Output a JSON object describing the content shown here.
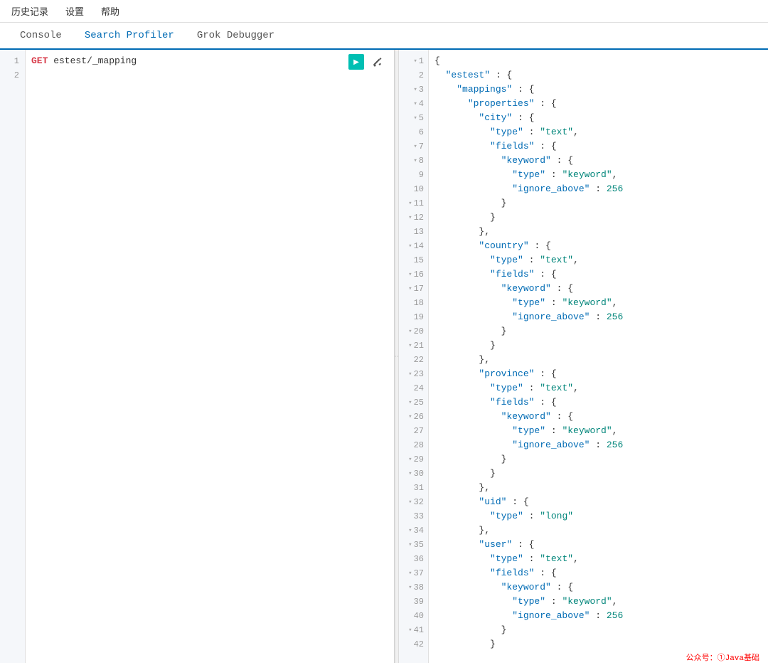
{
  "menu": {
    "items": [
      "历史记录",
      "设置",
      "帮助"
    ]
  },
  "tabs": [
    {
      "id": "console",
      "label": "Console",
      "active": false
    },
    {
      "id": "search-profiler",
      "label": "Search Profiler",
      "active": true
    },
    {
      "id": "grok-debugger",
      "label": "Grok Debugger",
      "active": false
    }
  ],
  "editor": {
    "lines": [
      {
        "num": 1,
        "content": "GET estest/_mapping"
      },
      {
        "num": 2,
        "content": ""
      }
    ]
  },
  "output": {
    "lines": [
      {
        "num": 1,
        "fold": true,
        "text": "{"
      },
      {
        "num": 2,
        "fold": false,
        "text": "  \"estest\" : {"
      },
      {
        "num": 3,
        "fold": true,
        "text": "    \"mappings\" : {"
      },
      {
        "num": 4,
        "fold": true,
        "text": "      \"properties\" : {"
      },
      {
        "num": 5,
        "fold": true,
        "text": "        \"city\" : {"
      },
      {
        "num": 6,
        "fold": false,
        "text": "          \"type\" : \"text\","
      },
      {
        "num": 7,
        "fold": true,
        "text": "          \"fields\" : {"
      },
      {
        "num": 8,
        "fold": true,
        "text": "            \"keyword\" : {"
      },
      {
        "num": 9,
        "fold": false,
        "text": "              \"type\" : \"keyword\","
      },
      {
        "num": 10,
        "fold": false,
        "text": "              \"ignore_above\" : 256"
      },
      {
        "num": 11,
        "fold": true,
        "text": "            }"
      },
      {
        "num": 12,
        "fold": true,
        "text": "          }"
      },
      {
        "num": 13,
        "fold": false,
        "text": "        },"
      },
      {
        "num": 14,
        "fold": true,
        "text": "        \"country\" : {"
      },
      {
        "num": 15,
        "fold": false,
        "text": "          \"type\" : \"text\","
      },
      {
        "num": 16,
        "fold": true,
        "text": "          \"fields\" : {"
      },
      {
        "num": 17,
        "fold": true,
        "text": "            \"keyword\" : {"
      },
      {
        "num": 18,
        "fold": false,
        "text": "              \"type\" : \"keyword\","
      },
      {
        "num": 19,
        "fold": false,
        "text": "              \"ignore_above\" : 256"
      },
      {
        "num": 20,
        "fold": true,
        "text": "            }"
      },
      {
        "num": 21,
        "fold": true,
        "text": "          }"
      },
      {
        "num": 22,
        "fold": false,
        "text": "        },"
      },
      {
        "num": 23,
        "fold": true,
        "text": "        \"province\" : {"
      },
      {
        "num": 24,
        "fold": false,
        "text": "          \"type\" : \"text\","
      },
      {
        "num": 25,
        "fold": true,
        "text": "          \"fields\" : {"
      },
      {
        "num": 26,
        "fold": true,
        "text": "            \"keyword\" : {"
      },
      {
        "num": 27,
        "fold": false,
        "text": "              \"type\" : \"keyword\","
      },
      {
        "num": 28,
        "fold": false,
        "text": "              \"ignore_above\" : 256"
      },
      {
        "num": 29,
        "fold": true,
        "text": "            }"
      },
      {
        "num": 30,
        "fold": true,
        "text": "          }"
      },
      {
        "num": 31,
        "fold": false,
        "text": "        },"
      },
      {
        "num": 32,
        "fold": true,
        "text": "        \"uid\" : {"
      },
      {
        "num": 33,
        "fold": false,
        "text": "          \"type\" : \"long\""
      },
      {
        "num": 34,
        "fold": true,
        "text": "        },"
      },
      {
        "num": 35,
        "fold": true,
        "text": "        \"user\" : {"
      },
      {
        "num": 36,
        "fold": false,
        "text": "          \"type\" : \"text\","
      },
      {
        "num": 37,
        "fold": true,
        "text": "          \"fields\" : {"
      },
      {
        "num": 38,
        "fold": true,
        "text": "            \"keyword\" : {"
      },
      {
        "num": 39,
        "fold": false,
        "text": "              \"type\" : \"keyword\","
      },
      {
        "num": 40,
        "fold": false,
        "text": "              \"ignore_above\" : 256"
      },
      {
        "num": 41,
        "fold": true,
        "text": "            }"
      },
      {
        "num": 42,
        "fold": false,
        "text": "          }"
      }
    ]
  },
  "watermark": "公众号：①Java基础",
  "colors": {
    "accent": "#006bb4",
    "key_color": "#006bb4",
    "string_color": "#00857a",
    "method_color": "#d73a49"
  }
}
